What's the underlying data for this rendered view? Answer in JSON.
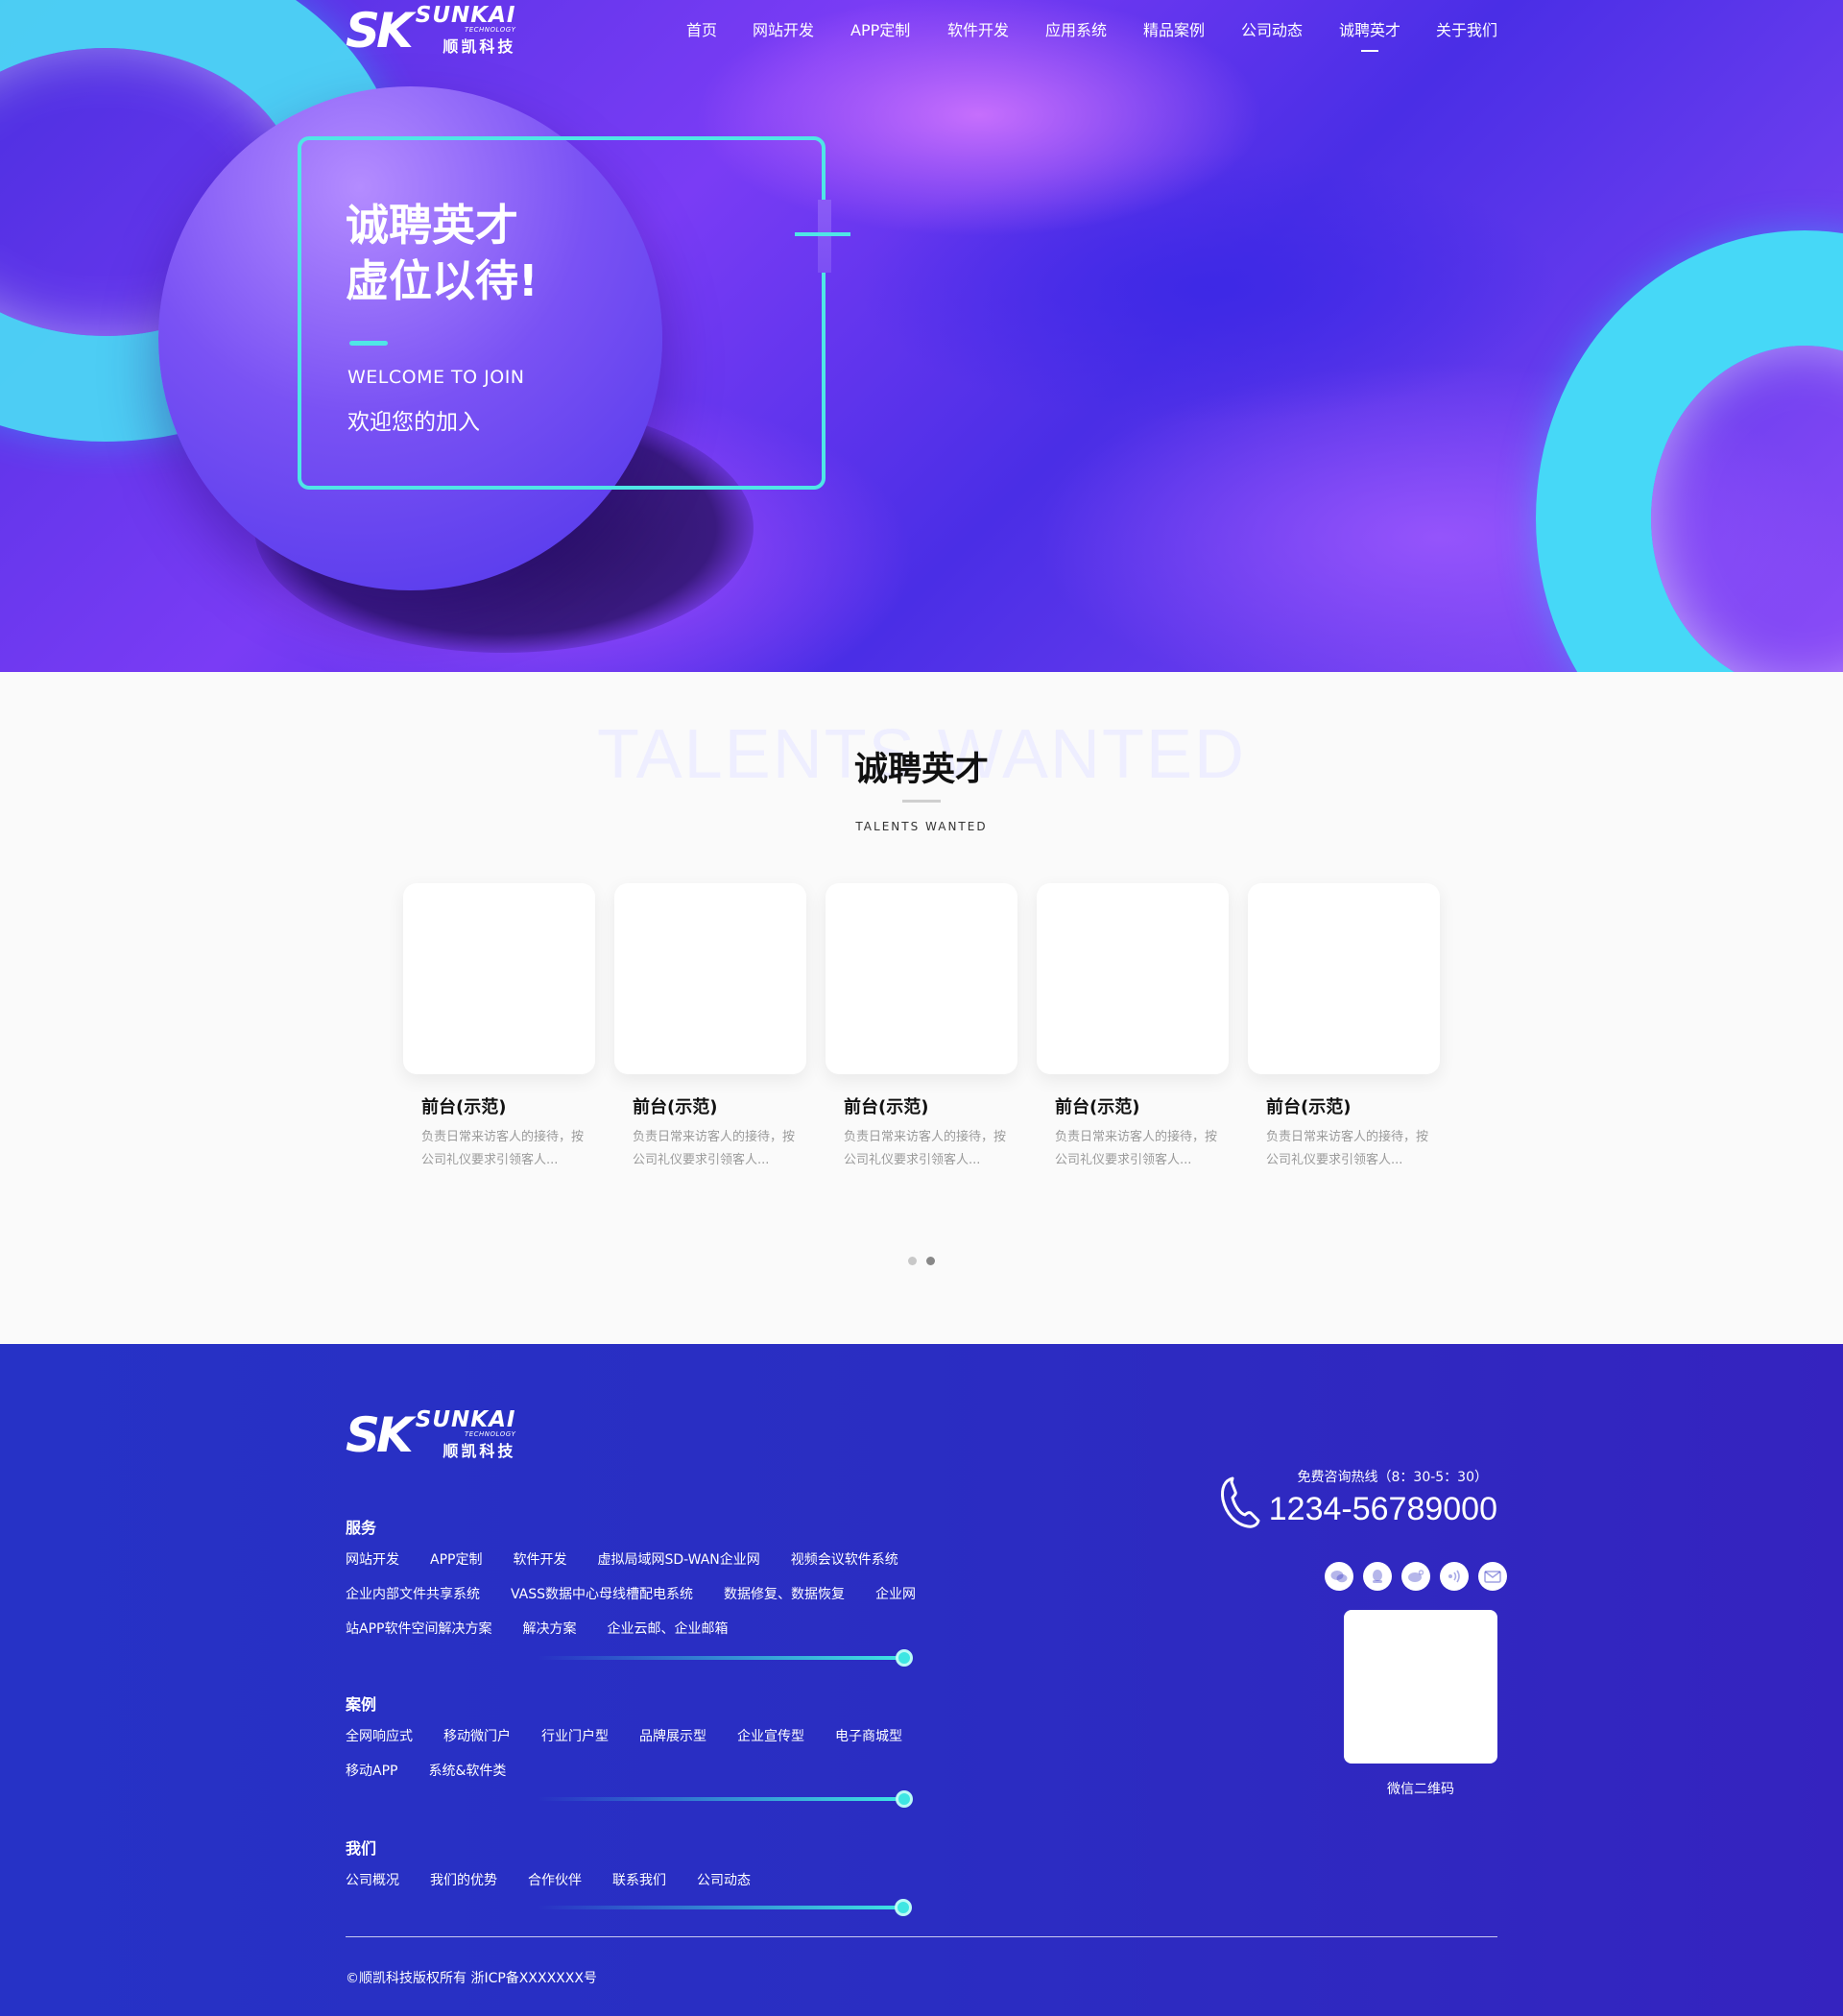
{
  "brand": {
    "mark": "SK",
    "name_en": "SUNKAI",
    "tagline_en": "TECHNOLOGY",
    "name_cn": "顺凯科技"
  },
  "nav": {
    "items": [
      {
        "label": "首页"
      },
      {
        "label": "网站开发"
      },
      {
        "label": "APP定制"
      },
      {
        "label": "软件开发"
      },
      {
        "label": "应用系统"
      },
      {
        "label": "精品案例"
      },
      {
        "label": "公司动态"
      },
      {
        "label": "诚聘英才",
        "active": true
      },
      {
        "label": "关于我们"
      }
    ]
  },
  "hero": {
    "title_line1": "诚聘英才",
    "title_line2": "虚位以待!",
    "sub_en": "WELCOME TO JOIN",
    "sub_cn": "欢迎您的加入"
  },
  "talents": {
    "bg_text": "TALENTS WANTED",
    "title": "诚聘英才",
    "subtitle": "TALENTS WANTED",
    "cards": [
      {
        "title": "前台(示范)",
        "desc": "负责日常来访客人的接待，按公司礼仪要求引领客人..."
      },
      {
        "title": "前台(示范)",
        "desc": "负责日常来访客人的接待，按公司礼仪要求引领客人..."
      },
      {
        "title": "前台(示范)",
        "desc": "负责日常来访客人的接待，按公司礼仪要求引领客人..."
      },
      {
        "title": "前台(示范)",
        "desc": "负责日常来访客人的接待，按公司礼仪要求引领客人..."
      },
      {
        "title": "前台(示范)",
        "desc": "负责日常来访客人的接待，按公司礼仪要求引领客人..."
      }
    ],
    "pagination": {
      "pages": 2,
      "current": 2
    }
  },
  "footer": {
    "services": {
      "title": "服务",
      "links": [
        "网站开发",
        "APP定制",
        "软件开发",
        "虚拟局域网SD-WAN企业网",
        "视频会议软件系统",
        "企业内部文件共享系统",
        "VASS数据中心母线槽配电系统",
        "数据修复、数据恢复",
        "企业网",
        "站APP软件空间解决方案",
        "解决方案",
        "企业云邮、企业邮箱"
      ]
    },
    "cases": {
      "title": "案例",
      "links": [
        "全网响应式",
        "移动微门户",
        "行业门户型",
        "品牌展示型",
        "企业宣传型",
        "电子商城型",
        "移动APP",
        "系统&软件类"
      ]
    },
    "about": {
      "title": "我们",
      "links": [
        "公司概况",
        "我们的优势",
        "合作伙伴",
        "联系我们",
        "公司动态"
      ]
    },
    "hotline_label": "免费咨询热线（8：30-5：30）",
    "hotline": "1234-56789000",
    "socials": [
      "wechat-icon",
      "qq-icon",
      "weibo-icon",
      "voice-icon",
      "mail-icon"
    ],
    "qr_label": "微信二维码",
    "copyright": "©顺凯科技版权所有   浙ICP备XXXXXXX号"
  },
  "colors": {
    "accent": "#4fe6e6",
    "footer_bg": "#2a2dc2",
    "hero_purple": "#7a3cf5"
  }
}
